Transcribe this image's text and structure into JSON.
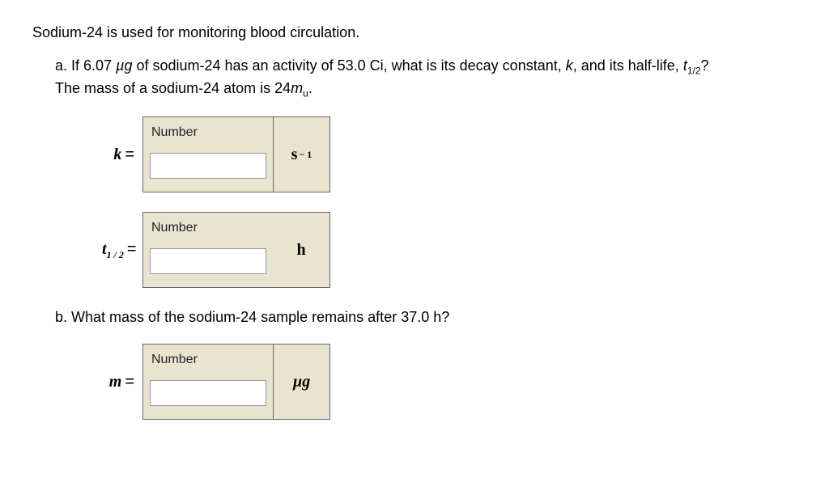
{
  "intro": "Sodium-24 is used for monitoring blood circulation.",
  "partA": {
    "label": "a.",
    "line1_prefix": "If 6.07 ",
    "line1_unit": "µg",
    "line1_mid": " of sodium-24 has an activity of 53.0 Ci, what is its decay constant, ",
    "k": "k",
    "line1_mid2": ", and its half-life, ",
    "t12": "t",
    "t12_sub": "1/2",
    "line1_end": "?",
    "line2_prefix": "The mass of a sodium-24 atom is 24",
    "mu_m": "m",
    "mu_u": "u",
    "line2_end": "."
  },
  "inputK": {
    "numberLabel": "Number",
    "varLabel": "k",
    "eq": "=",
    "unit_base": "s",
    "unit_exp": "− 1"
  },
  "inputT": {
    "numberLabel": "Number",
    "var_t": "t",
    "var_sub": "1 / 2",
    "eq": "=",
    "unit": "h"
  },
  "partB": {
    "label": "b.",
    "text": "What mass of the sodium-24 sample remains after 37.0 h?"
  },
  "inputM": {
    "numberLabel": "Number",
    "varLabel": "m",
    "eq": "=",
    "unit": "µg"
  }
}
